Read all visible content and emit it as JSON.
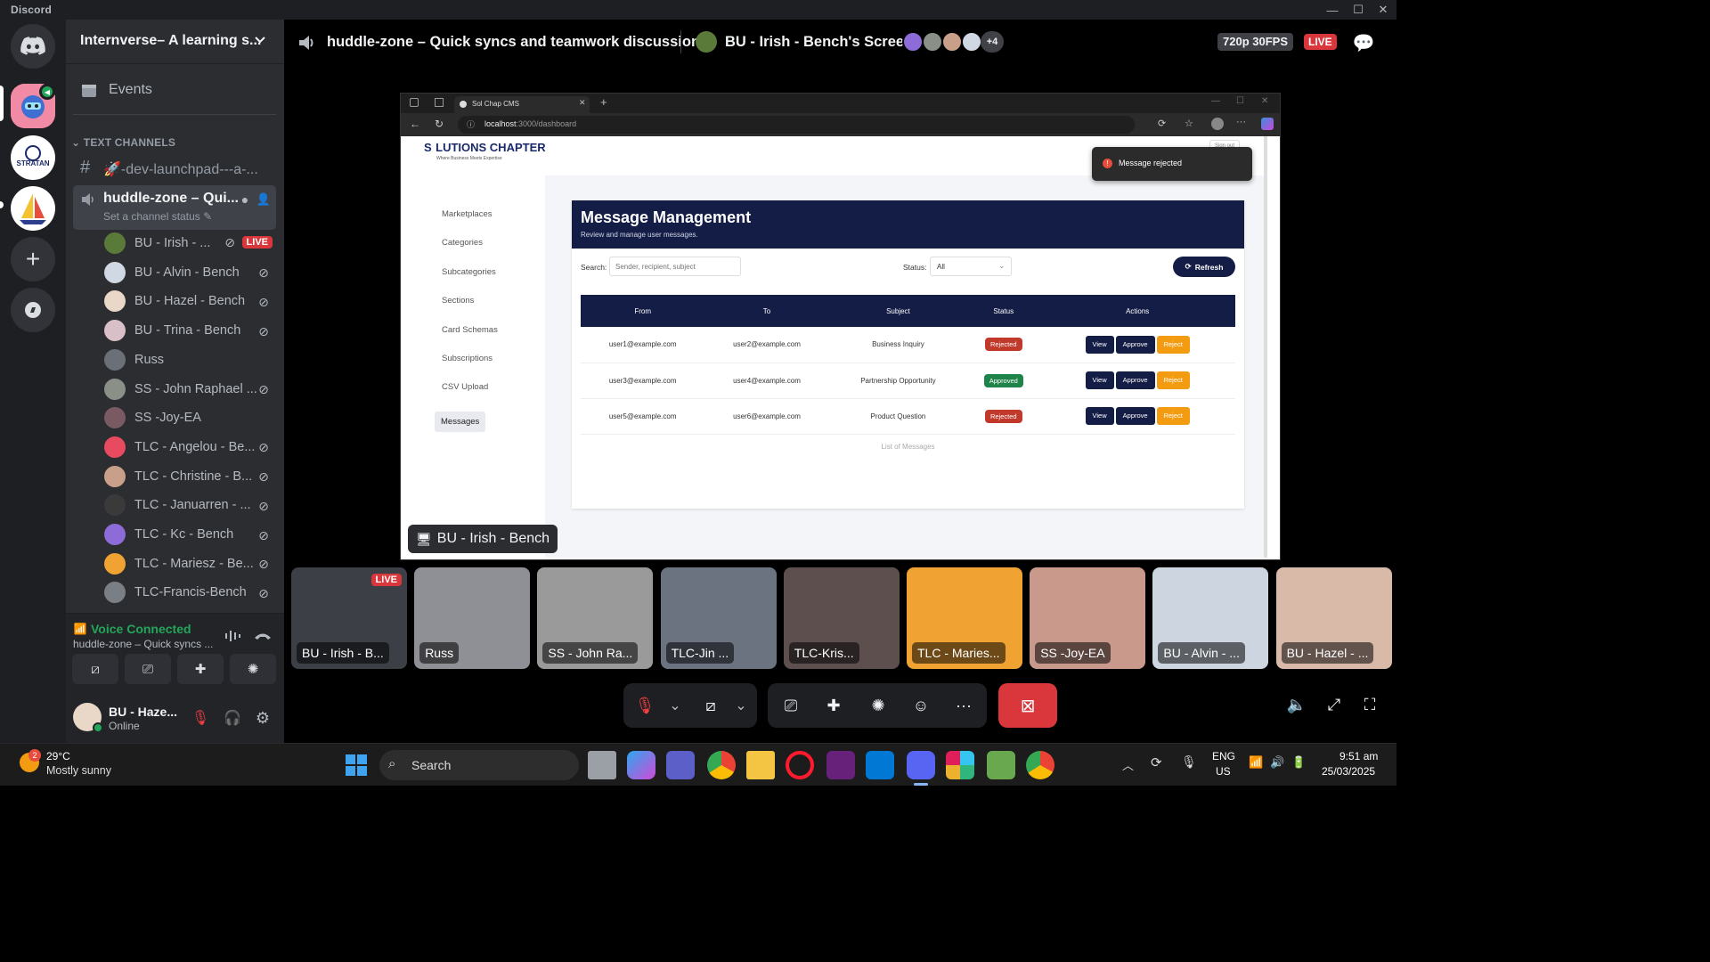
{
  "app": {
    "brand": "Discord"
  },
  "server": {
    "name": "Internverse– A learning s..."
  },
  "sidebar": {
    "events_label": "Events",
    "section_label": "TEXT CHANNELS",
    "text_channel": "🚀-dev-launchpad---a-...",
    "voice_channel": {
      "name": "huddle-zone – Qui...",
      "status": "Set a channel status"
    },
    "users": [
      {
        "name": "BU - Irish - ...",
        "live": "LIVE",
        "color": "#5a7a3a"
      },
      {
        "name": "BU - Alvin - Bench",
        "color": "#cfd8e3"
      },
      {
        "name": "BU - Hazel - Bench",
        "color": "#e9d7c8"
      },
      {
        "name": "BU - Trina - Bench",
        "color": "#d9c0c8"
      },
      {
        "name": "Russ",
        "color": "#6b6f78"
      },
      {
        "name": "SS - John Raphael ...",
        "color": "#8a8f88"
      },
      {
        "name": "SS -Joy-EA",
        "color": "#7a5a62"
      },
      {
        "name": "TLC - Angelou - Be...",
        "color": "#e84a5f"
      },
      {
        "name": "TLC - Christine - B...",
        "color": "#c8a08a"
      },
      {
        "name": "TLC - Januarren - ...",
        "color": "#3a3a3a"
      },
      {
        "name": "TLC - Kc - Bench",
        "color": "#8d6bd8"
      },
      {
        "name": "TLC - Mariesz - Be...",
        "color": "#f0a232"
      },
      {
        "name": "TLC-Francis-Bench",
        "color": "#7a7f86"
      }
    ]
  },
  "voice_panel": {
    "status": "Voice Connected",
    "channel": "huddle-zone – Quick syncs ..."
  },
  "user_panel": {
    "name": "BU - Haze...",
    "status": "Online"
  },
  "stage": {
    "channel_title": "huddle-zone – Quick syncs and teamwork discussions",
    "screen_title": "BU - Irish - Bench's Screen",
    "extra_count": "+4",
    "quality": "720p 30FPS",
    "live_badge": "LIVE",
    "stream_label": "BU - Irish - Bench"
  },
  "browser": {
    "tab_title": "Sol Chap CMS",
    "url_host": "localhost",
    "url_path": ":3000/dashboard",
    "logo_text": "LUTIONS CHAPTER",
    "logo_prefix": "S",
    "logo_tagline": "Where Business Meets Expertise",
    "signout_label": "Sign out",
    "toast": "Message rejected",
    "nav": [
      "Marketplaces",
      "Categories",
      "Subcategories",
      "Sections",
      "Card Schemas",
      "Subscriptions",
      "CSV Upload",
      "Messages"
    ],
    "header": {
      "title": "Message Management",
      "subtitle": "Review and manage user messages."
    },
    "search_label": "Search:",
    "search_placeholder": "Sender, recipient, subject",
    "status_label": "Status:",
    "status_value": "All",
    "refresh_label": "Refresh",
    "columns": [
      "From",
      "To",
      "Subject",
      "Status",
      "Actions"
    ],
    "rows": [
      {
        "from": "user1@example.com",
        "to": "user2@example.com",
        "subject": "Business Inquiry",
        "status": "Rejected",
        "status_color": "#c0392b"
      },
      {
        "from": "user3@example.com",
        "to": "user4@example.com",
        "subject": "Partnership Opportunity",
        "status": "Approved",
        "status_color": "#1e8449"
      },
      {
        "from": "user5@example.com",
        "to": "user6@example.com",
        "subject": "Product Question",
        "status": "Rejected",
        "status_color": "#c0392b"
      }
    ],
    "action_labels": {
      "view": "View",
      "approve": "Approve",
      "reject": "Reject"
    },
    "caption": "List of Messages"
  },
  "tiles": [
    {
      "label": "BU - Irish - B...",
      "live": "LIVE",
      "color": "#3c3f45"
    },
    {
      "label": "Russ",
      "color": "#8f8f96"
    },
    {
      "label": "SS - John Ra...",
      "color": "#9a9a9a"
    },
    {
      "label": "TLC-Jin ...",
      "color": "#6b7280"
    },
    {
      "label": "TLC-Kris...",
      "color": "#5e4f4f"
    },
    {
      "label": "TLC - Maries...",
      "color": "#f0a232"
    },
    {
      "label": "SS -Joy-EA",
      "color": "#c99a8c"
    },
    {
      "label": "BU - Alvin - ...",
      "color": "#cdd6e0"
    },
    {
      "label": "BU - Hazel - ...",
      "color": "#d9b9a8"
    }
  ],
  "taskbar": {
    "weather_badge": "2",
    "temp": "29°C",
    "weather": "Mostly sunny",
    "search": "Search",
    "lang1": "ENG",
    "lang2": "US",
    "time": "9:51 am",
    "date": "25/03/2025"
  },
  "colors": {
    "blurple": "#5865f2",
    "green": "#23a55a",
    "live": "#da373c",
    "navy": "#141d46",
    "orange": "#f39c12"
  }
}
